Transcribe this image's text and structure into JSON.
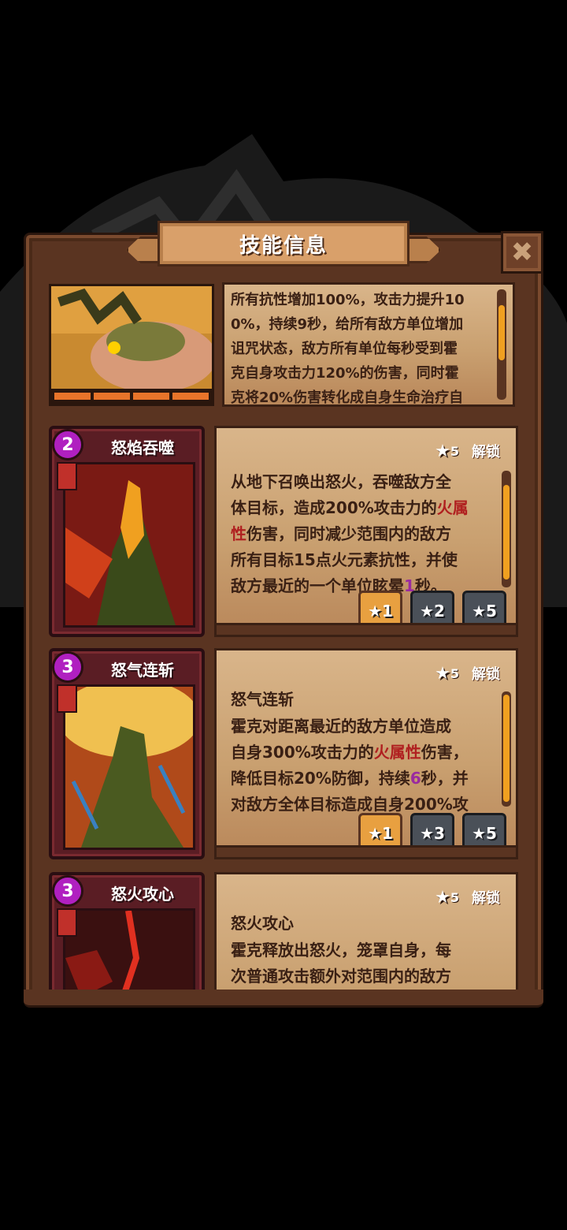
{
  "title": "技能信息",
  "close_icon": "close-icon",
  "hero": {
    "description_lines": [
      "所有抗性增加100%，攻击力提升10",
      "0%，持续9秒，给所有敌方单位增加",
      "诅咒状态，敌方所有单位每秒受到霍",
      "克自身攻击力120%的伤害，同时霍",
      "克将20%伤害转化成自身生命治疗自"
    ]
  },
  "skills": [
    {
      "name": "怒焰吞噬",
      "level": "2",
      "unlock_stars": "5",
      "unlock_label": "解锁",
      "title": "",
      "text_parts": [
        {
          "t": "从地下召唤出怒火，吞噬敌方全"
        },
        {
          "t": "体目标，造成200%攻击力的"
        },
        {
          "t": "火属",
          "hl": "fire"
        },
        {
          "t": "性",
          "hl": "fire"
        },
        {
          "t": "伤害，同时减少范围内的敌方"
        },
        {
          "t": "所有目标15点火元素抗性，并使"
        },
        {
          "t": "敌方最近的一个单位眩晕"
        },
        {
          "t": "1",
          "hl": "purple"
        },
        {
          "t": "秒。"
        }
      ],
      "levels": [
        "1",
        "2",
        "5"
      ]
    },
    {
      "name": "怒气连斩",
      "level": "3",
      "unlock_stars": "5",
      "unlock_label": "解锁",
      "title": "怒气连斩",
      "text_parts": [
        {
          "t": "霍克对距离最近的敌方单位造成"
        },
        {
          "t": "自身300%攻击力的"
        },
        {
          "t": "火属性",
          "hl": "fire"
        },
        {
          "t": "伤害，"
        },
        {
          "t": "降低目标20%防御，持续"
        },
        {
          "t": "6",
          "hl": "purple"
        },
        {
          "t": "秒，并"
        },
        {
          "t": "对敌方全体目标造成自身200%攻"
        }
      ],
      "levels": [
        "1",
        "3",
        "5"
      ]
    },
    {
      "name": "怒火攻心",
      "level": "3",
      "unlock_stars": "5",
      "unlock_label": "解锁",
      "title": "怒火攻心",
      "text_parts": [
        {
          "t": "霍克释放出怒火，笼罩自身，每"
        },
        {
          "t": "次普通攻击额外对范围内的敌方"
        }
      ],
      "levels": []
    }
  ],
  "colors": {
    "accent": "#f0a020",
    "fire": "#b02020",
    "purple": "#9a2aa0",
    "frame": "#5a3421"
  }
}
